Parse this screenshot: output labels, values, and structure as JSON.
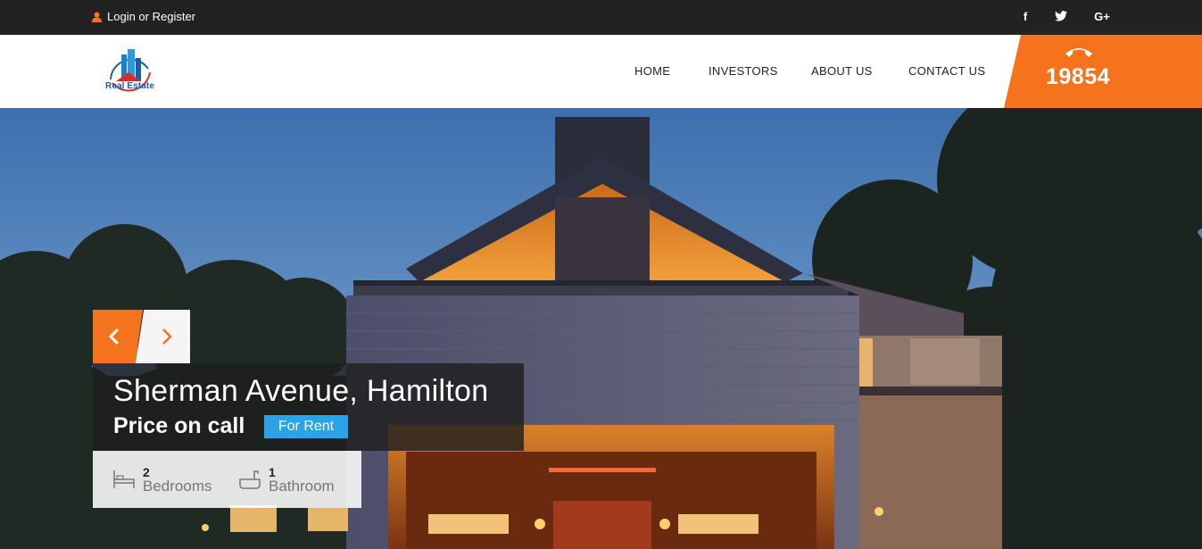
{
  "topbar": {
    "login_label": "Login or Register",
    "social": [
      {
        "name": "facebook",
        "glyph": "f"
      },
      {
        "name": "twitter",
        "glyph": "t"
      },
      {
        "name": "google-plus",
        "glyph": "G+"
      }
    ]
  },
  "header": {
    "logo_text": "Real Estate",
    "nav": [
      "HOME",
      "INVESTORS",
      "ABOUT US",
      "CONTACT US"
    ],
    "phone_number": "19854"
  },
  "slide": {
    "title": "Sherman Avenue, Hamilton",
    "price": "Price on call",
    "badge": "For Rent",
    "bedrooms": {
      "count": "2",
      "label": "Bedrooms"
    },
    "bathrooms": {
      "count": "1",
      "label": "Bathroom"
    }
  },
  "colors": {
    "accent": "#f4731c",
    "badge": "#2aa4e6",
    "topbar": "#222222"
  }
}
